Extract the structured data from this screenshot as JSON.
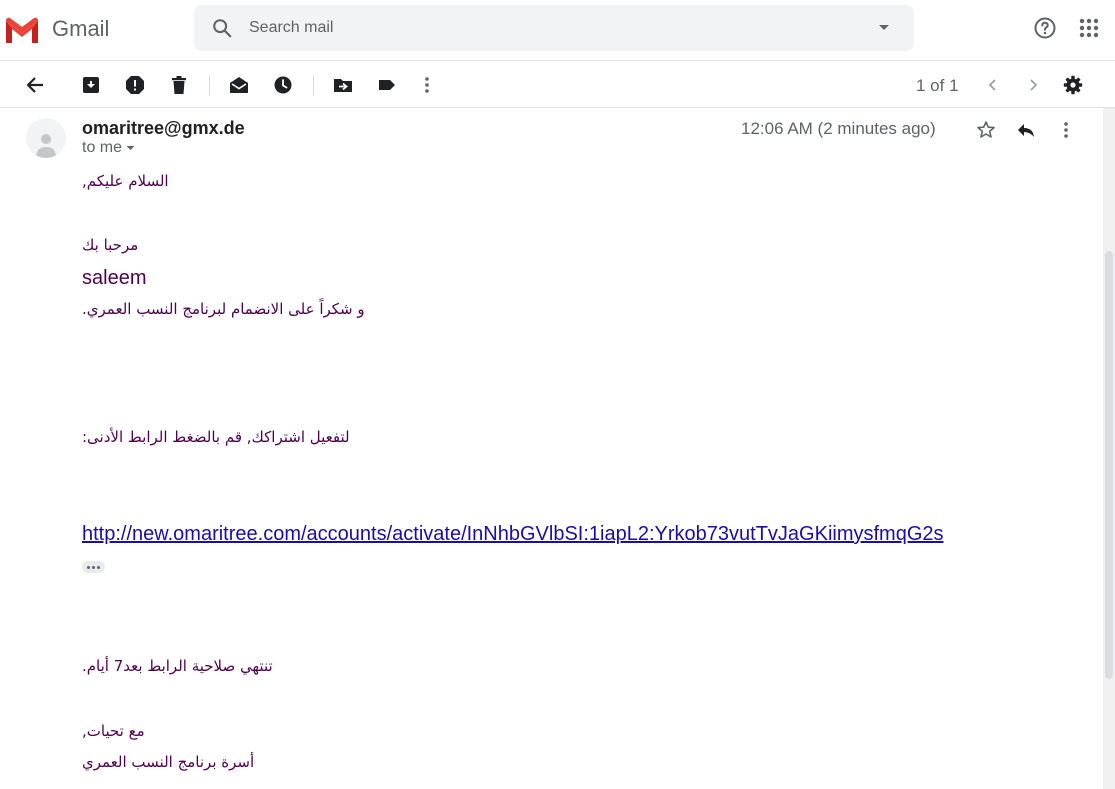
{
  "header": {
    "app_name": "Gmail",
    "search_placeholder": "Search mail"
  },
  "toolbar": {
    "pager": "1 of 1",
    "icons": [
      "back-arrow-icon",
      "archive-icon",
      "report-spam-icon",
      "delete-icon",
      "mark-unread-icon",
      "snooze-icon",
      "move-to-icon",
      "label-icon",
      "more-vert-icon",
      "chevron-left-icon",
      "chevron-right-icon",
      "settings-gear-icon"
    ]
  },
  "message": {
    "sender": "omaritree@gmx.de",
    "recipient": "to me",
    "time": "12:06 AM (2 minutes ago)",
    "body": {
      "greeting": "السلام عليكم,",
      "welcome": "مرحبا بك",
      "name": "saleem",
      "thanks": "و شكراً على الانضمام لبرنامج النسب العمري.",
      "activate_prompt": "لتفعيل اشتراكك, قم بالضغط الرابط الأدنى:",
      "activation_link": "http://new.omaritree.com/accounts/activate/InNhbGVlbSI:1iapL2:Yrkob73vutTvJaGKiimysfmqG2s",
      "expiry": "تنتهي صلاحية الرابط بعد7 أيام.",
      "closing": "مع تحيات,",
      "signature": "أسرة برنامج النسب العمري"
    }
  },
  "colors": {
    "body_text": "#500050",
    "link": "#1a0dab",
    "gmail_red": "#ea4335"
  }
}
